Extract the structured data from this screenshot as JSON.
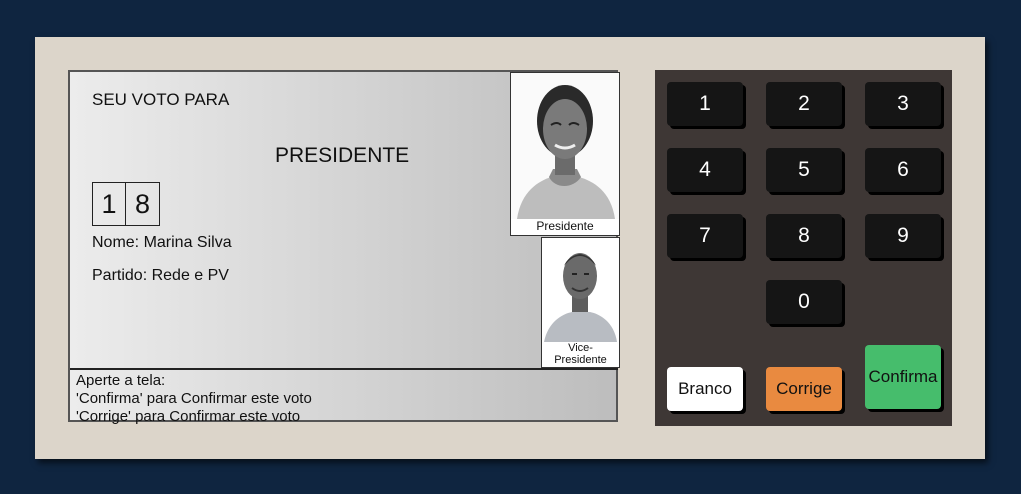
{
  "screen": {
    "header": "SEU VOTO PARA",
    "office": "PRESIDENTE",
    "digits": [
      "1",
      "8"
    ],
    "name_line": "Nome: Marina Silva",
    "party_line": "Partido: Rede e PV",
    "photo_president_caption": "Presidente",
    "photo_vice_caption_line1": "Vice-",
    "photo_vice_caption_line2": "Presidente",
    "footer": {
      "line1": "Aperte a tela:",
      "line2": "'Confirma' para Confirmar este voto",
      "line3": "'Corrige' para Confirmar este voto"
    }
  },
  "keypad": {
    "keys": [
      "1",
      "2",
      "3",
      "4",
      "5",
      "6",
      "7",
      "8",
      "9",
      "0"
    ],
    "branco": "Branco",
    "corrige": "Corrige",
    "confirma": "Confirma"
  },
  "colors": {
    "background": "#0f2540",
    "machine": "#dcd5ca",
    "keypad": "#3e3735",
    "branco": "#ffffff",
    "corrige": "#e98a40",
    "confirma": "#46bd6c"
  }
}
